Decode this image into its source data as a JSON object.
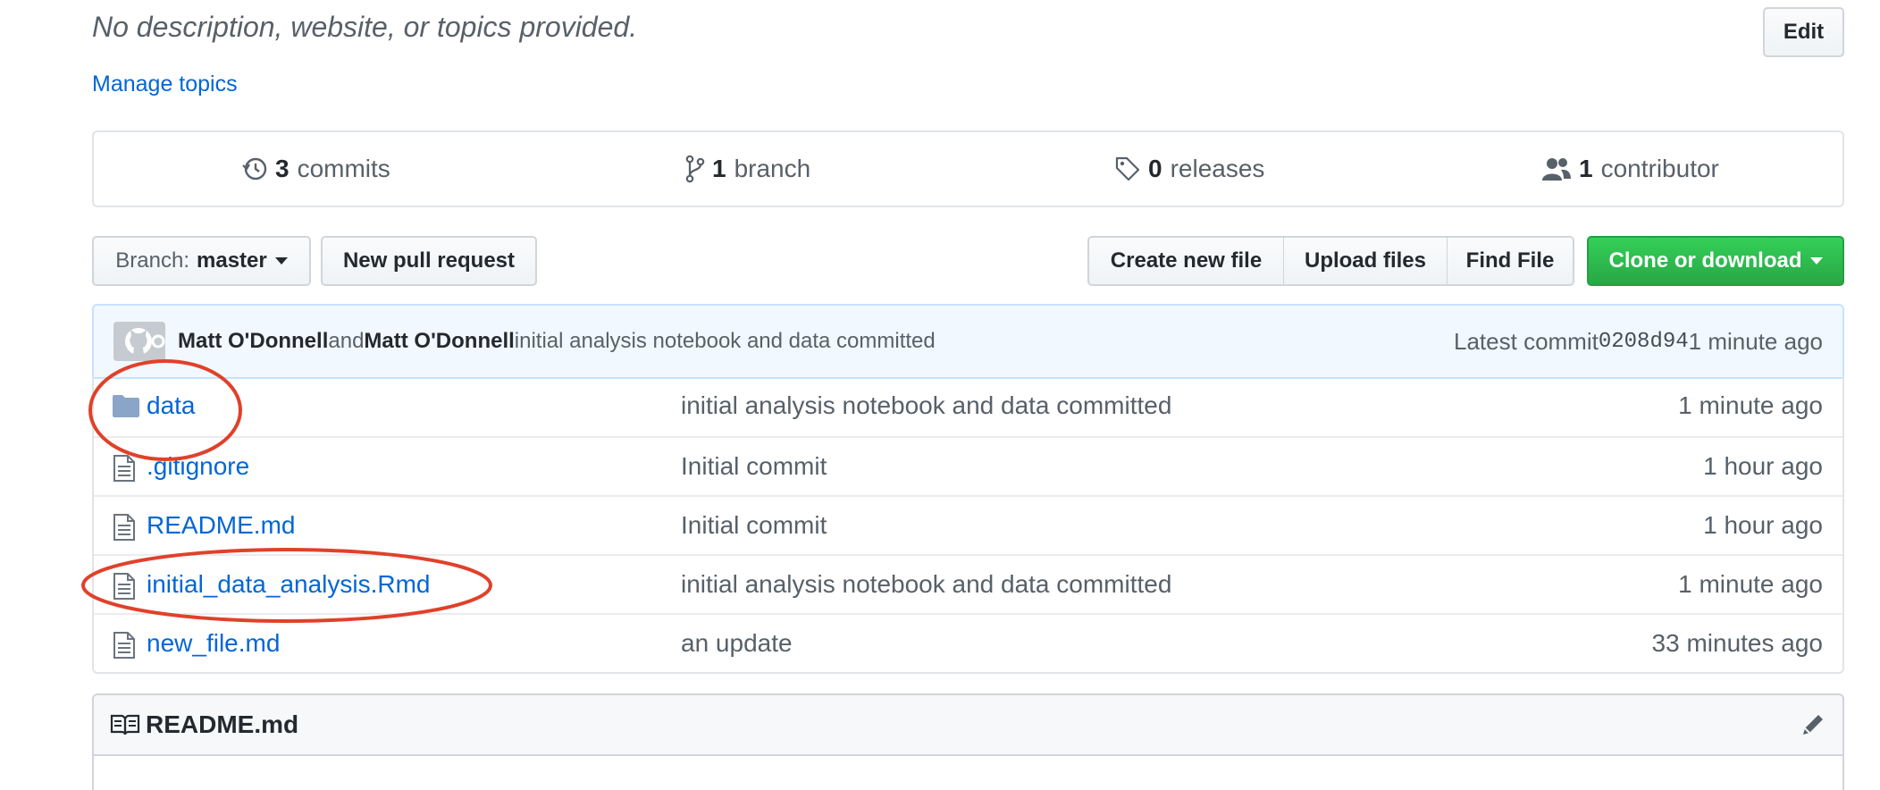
{
  "repo": {
    "description": "No description, website, or topics provided.",
    "manage_topics": "Manage topics",
    "edit_label": "Edit"
  },
  "summary": {
    "commits": {
      "count": "3",
      "label": "commits",
      "icon": "history-icon"
    },
    "branches": {
      "count": "1",
      "label": "branch",
      "icon": "git-branch-icon"
    },
    "releases": {
      "count": "0",
      "label": "releases",
      "icon": "tag-icon"
    },
    "contributors": {
      "count": "1",
      "label": "contributor",
      "icon": "people-icon"
    }
  },
  "toolbar": {
    "branch_prefix": "Branch:",
    "branch_name": "master",
    "new_pull_request": "New pull request",
    "create_new_file": "Create new file",
    "upload_files": "Upload files",
    "find_file": "Find File",
    "clone_or_download": "Clone or download"
  },
  "latest_commit": {
    "author": "Matt O'Donnell",
    "and": "and",
    "committer": "Matt O'Donnell",
    "message": "initial analysis notebook and data committed",
    "latest_label": "Latest commit",
    "sha": "0208d94",
    "time": "1 minute ago"
  },
  "files": [
    {
      "name": "data",
      "type": "folder",
      "message": "initial analysis notebook and data committed",
      "age": "1 minute ago"
    },
    {
      "name": ".gitignore",
      "type": "file",
      "message": "Initial commit",
      "age": "1 hour ago"
    },
    {
      "name": "README.md",
      "type": "file",
      "message": "Initial commit",
      "age": "1 hour ago"
    },
    {
      "name": "initial_data_analysis.Rmd",
      "type": "file",
      "message": "initial analysis notebook and data committed",
      "age": "1 minute ago"
    },
    {
      "name": "new_file.md",
      "type": "file",
      "message": "an update",
      "age": "33 minutes ago"
    }
  ],
  "readme": {
    "title": "README.md"
  },
  "colors": {
    "link": "#0366d6",
    "clone_green": "#28a745",
    "annotation_red": "#e0412a"
  }
}
